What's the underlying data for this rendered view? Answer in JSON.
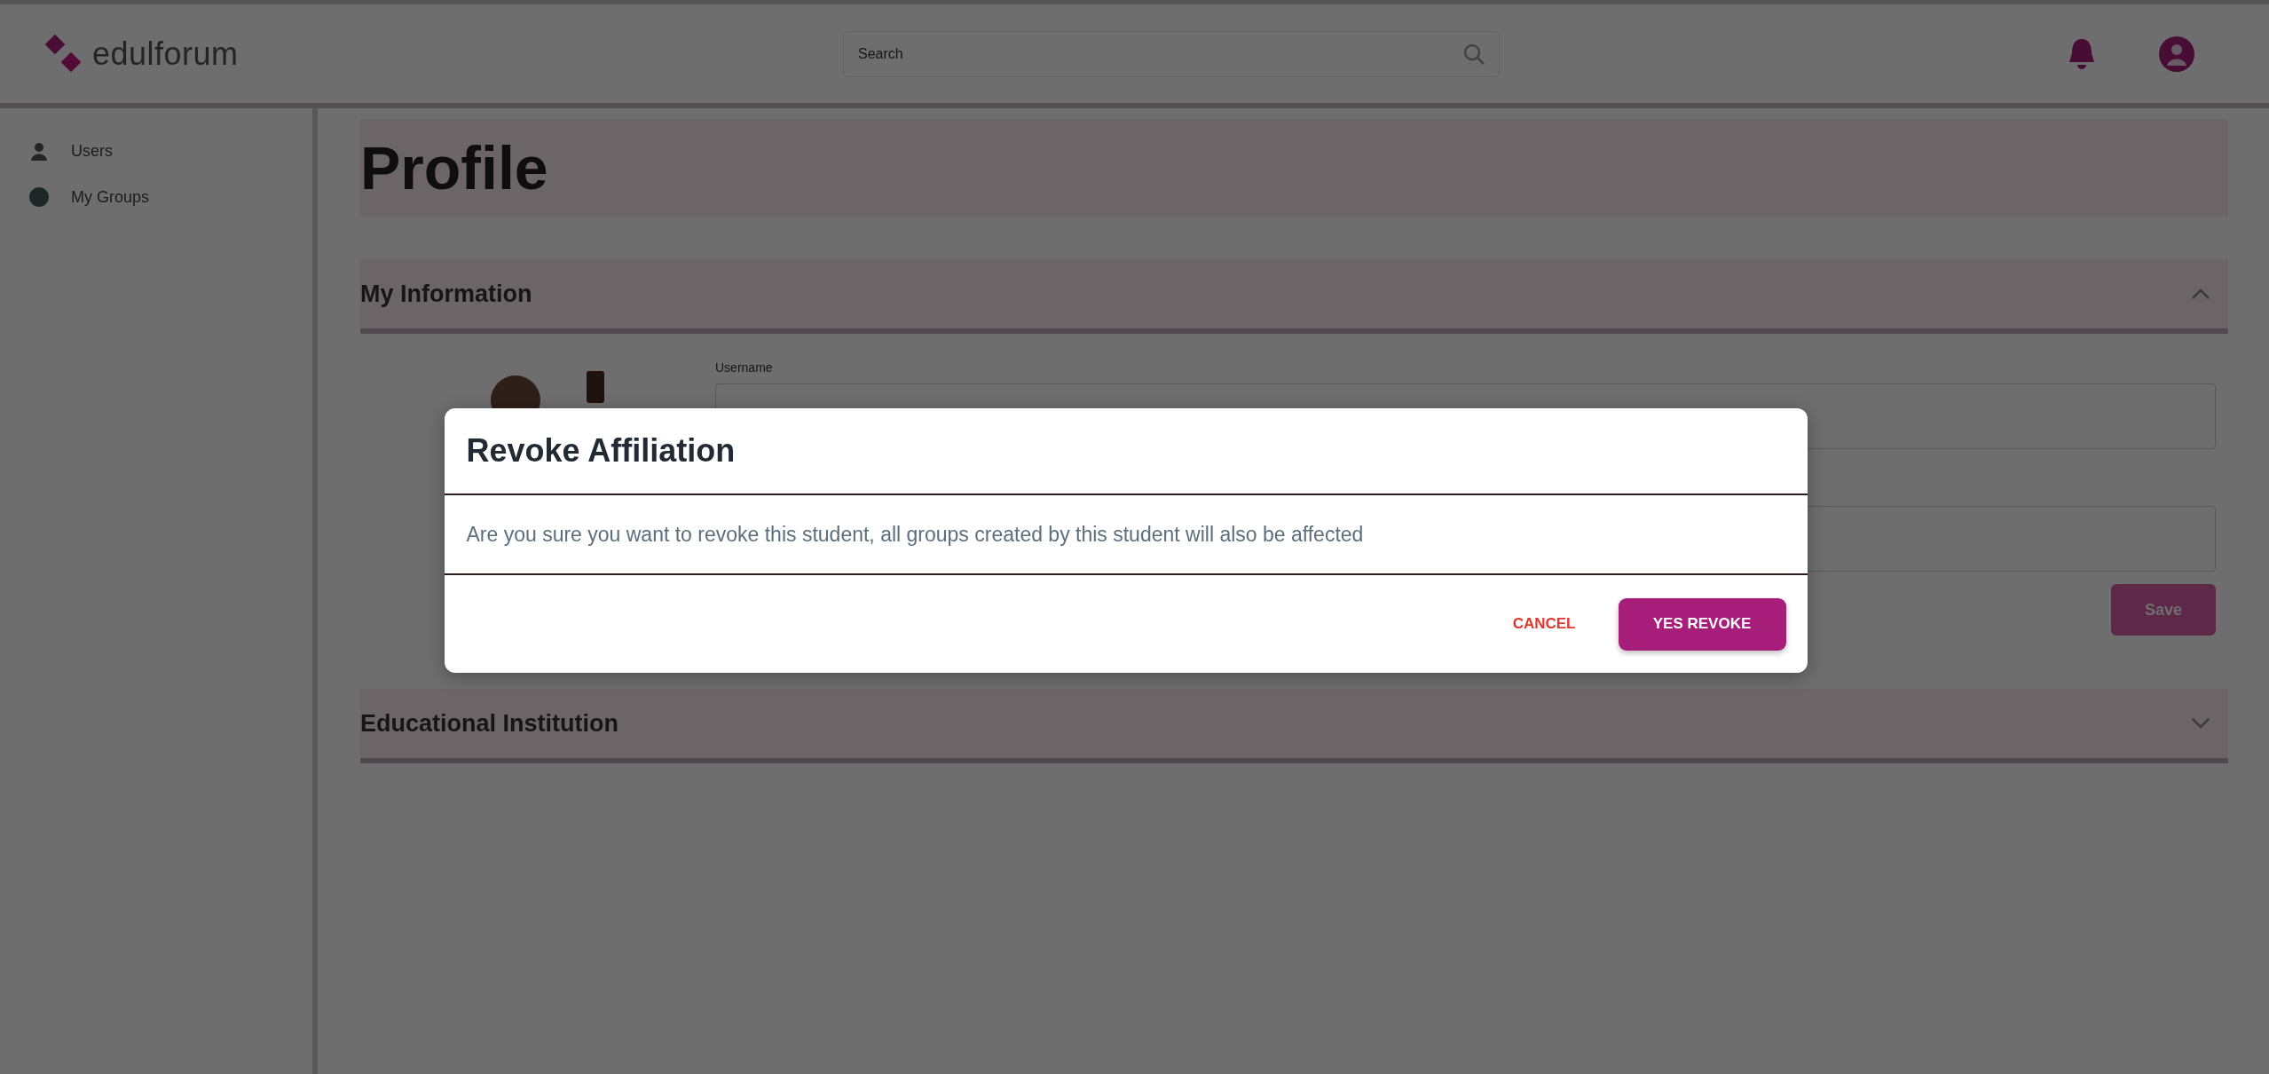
{
  "header": {
    "logo": "edulforum",
    "search": {
      "placeholder": "Search"
    }
  },
  "sidebar": {
    "items": [
      {
        "label": "Users",
        "selected": false
      },
      {
        "label": "My Groups",
        "selected": false
      }
    ]
  },
  "page": {
    "title": "Profile",
    "sections": [
      {
        "title": "My Information",
        "expanded": true,
        "fields": [
          {
            "kind": "labeled",
            "label": "Username"
          },
          {
            "kind": "bare"
          }
        ],
        "save": "Save"
      },
      {
        "title": "Educational Institution",
        "expanded": false
      }
    ]
  },
  "dialog": {
    "title": "Revoke Affiliation",
    "message": "Are you sure you want to revoke this student, all groups created by this student will also be affected",
    "buttons": [
      {
        "label": "CANCEL",
        "kind": "text"
      },
      {
        "label": "YES REVOKE",
        "kind": "primary"
      }
    ]
  }
}
